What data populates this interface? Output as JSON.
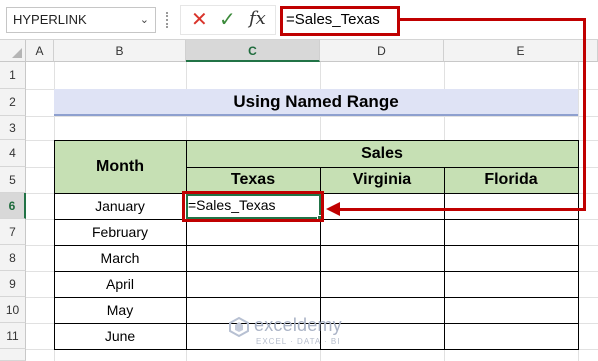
{
  "formula_bar": {
    "name_box": "HYPERLINK",
    "cancel_icon": "x-icon",
    "enter_icon": "check-icon",
    "fx_label": "fx",
    "formula": "=Sales_Texas"
  },
  "columns": [
    "A",
    "B",
    "C",
    "D",
    "E"
  ],
  "rows": [
    "1",
    "2",
    "3",
    "4",
    "5",
    "6",
    "7",
    "8",
    "9",
    "10",
    "11"
  ],
  "active_cell": "C6",
  "title": "Using Named Range",
  "table": {
    "month_header": "Month",
    "sales_header": "Sales",
    "regions": [
      "Texas",
      "Virginia",
      "Florida"
    ],
    "months": [
      "January",
      "February",
      "March",
      "April",
      "May",
      "June"
    ],
    "cell_c6": "=Sales_Texas"
  },
  "watermark": {
    "name": "exceldemy",
    "tagline": "EXCEL · DATA · BI"
  },
  "colors": {
    "header_fill": "#c6e0b4",
    "title_fill": "#dfe3f5",
    "highlight": "#c00000",
    "selection": "#217346"
  }
}
